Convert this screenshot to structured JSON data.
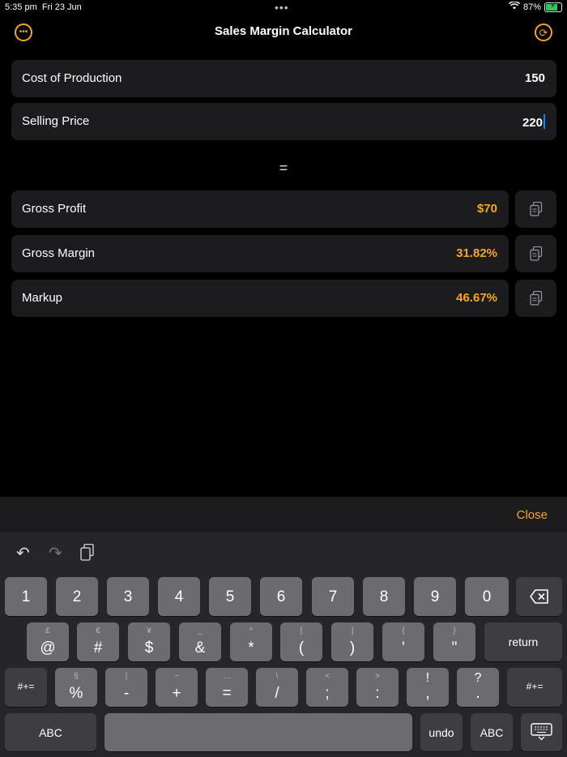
{
  "status": {
    "time": "5:35 pm",
    "date": "Fri 23 Jun",
    "battery": "87%",
    "dots": "•••"
  },
  "nav": {
    "title": "Sales Margin Calculator",
    "more_icon": "more-circle-icon",
    "refresh_icon": "refresh-circle-icon"
  },
  "inputs": {
    "cost_label": "Cost of Production",
    "cost_value": "150",
    "price_label": "Selling Price",
    "price_value": "220"
  },
  "equals": "=",
  "results": {
    "profit_label": "Gross Profit",
    "profit_value": "$70",
    "margin_label": "Gross Margin",
    "margin_value": "31.82%",
    "markup_label": "Markup",
    "markup_value": "46.67%"
  },
  "keyboard": {
    "close": "Close",
    "row1": [
      "1",
      "2",
      "3",
      "4",
      "5",
      "6",
      "7",
      "8",
      "9",
      "0"
    ],
    "row2_main": [
      "@",
      "#",
      "$",
      "&",
      "*",
      "(",
      ")",
      "'",
      "\""
    ],
    "row2_sub": [
      "£",
      "€",
      "¥",
      "_",
      "^",
      "[",
      "]",
      "{",
      "}"
    ],
    "return": "return",
    "row3_main": [
      "%",
      "-",
      "+",
      "=",
      "/",
      ";",
      ":",
      ",",
      "."
    ],
    "row3_sub": [
      "§",
      "|",
      "~",
      "…",
      "\\",
      "<",
      ">",
      "!",
      "?"
    ],
    "symbols": "#+=",
    "abc": "ABC",
    "undo": "undo"
  },
  "colors": {
    "accent": "#f5a623",
    "background": "#000000",
    "card": "#1c1c1e"
  }
}
